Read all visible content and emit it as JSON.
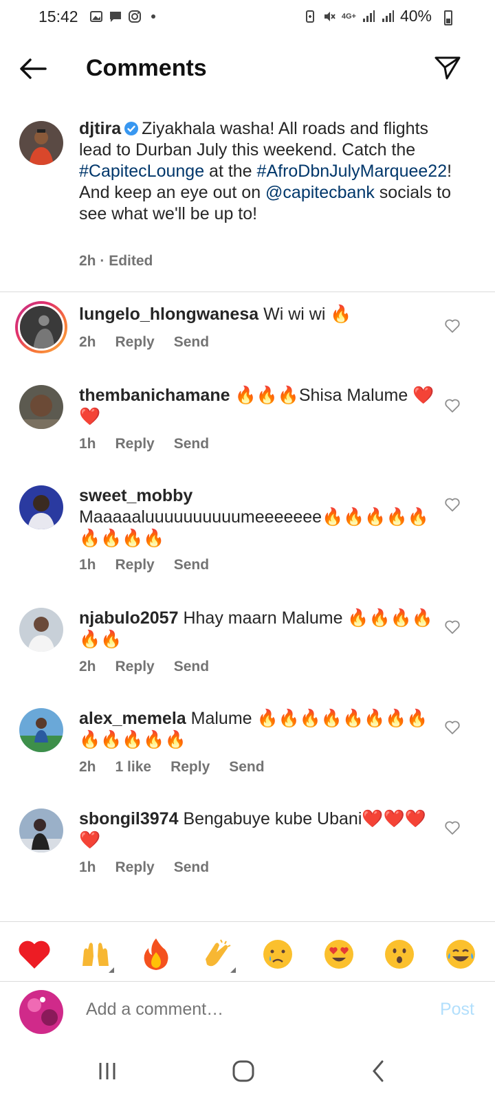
{
  "status_bar": {
    "time": "15:42",
    "battery_pct": "40%",
    "network": "4G+",
    "icons": [
      "gallery-icon",
      "message-icon",
      "instagram-icon",
      "dot-icon",
      "battery-saver-icon",
      "mute-icon",
      "signal-icon",
      "signal-icon",
      "battery-icon"
    ]
  },
  "header": {
    "title": "Comments"
  },
  "caption": {
    "username": "djtira",
    "text_1": "Ziyakhala washa! All roads and flights lead to Durban July this weekend. Catch the ",
    "tag_1": "#CapitecLounge",
    "text_2": " at the ",
    "tag_2": "#AfroDbnJulyMarquee22",
    "text_3": "! And keep an eye out on ",
    "tag_3": "@capitecbank",
    "text_4": " socials to see what we'll be up to!",
    "time": "2h",
    "edited": "Edited"
  },
  "comments": [
    {
      "username": "lungelo_hlongwanesa",
      "text": "Wi wi wi 🔥",
      "time": "2h",
      "likes": "",
      "reply": "Reply",
      "send": "Send"
    },
    {
      "username": "thembanichamane",
      "text": "🔥🔥🔥Shisa Malume ❤️❤️",
      "time": "1h",
      "likes": "",
      "reply": "Reply",
      "send": "Send"
    },
    {
      "username": "sweet_mobby",
      "text": "Maaaaaluuuuuuuuuumeeeeeee🔥🔥🔥🔥🔥🔥🔥🔥🔥",
      "time": "1h",
      "likes": "",
      "reply": "Reply",
      "send": "Send"
    },
    {
      "username": "njabulo2057",
      "text": "Hhay maarn Malume 🔥🔥🔥🔥🔥🔥",
      "time": "2h",
      "likes": "",
      "reply": "Reply",
      "send": "Send"
    },
    {
      "username": "alex_memela",
      "text": "Malume 🔥🔥🔥🔥🔥🔥🔥🔥🔥🔥🔥🔥🔥",
      "time": "2h",
      "likes": "1 like",
      "reply": "Reply",
      "send": "Send"
    },
    {
      "username": "sbongil3974",
      "text": "Bengabuye kube Ubani❤️❤️❤️❤️",
      "time": "1h",
      "likes": "",
      "reply": "Reply",
      "send": "Send"
    }
  ],
  "reactions": [
    "❤️",
    "🙌",
    "🔥",
    "👏",
    "😢",
    "😍",
    "😮",
    "😂"
  ],
  "compose": {
    "placeholder": "Add a comment…",
    "post_label": "Post"
  },
  "colors": {
    "link": "#00376b",
    "meta_gray": "#737373",
    "post_disabled": "#b2dffc",
    "verified_blue": "#3897f0"
  }
}
